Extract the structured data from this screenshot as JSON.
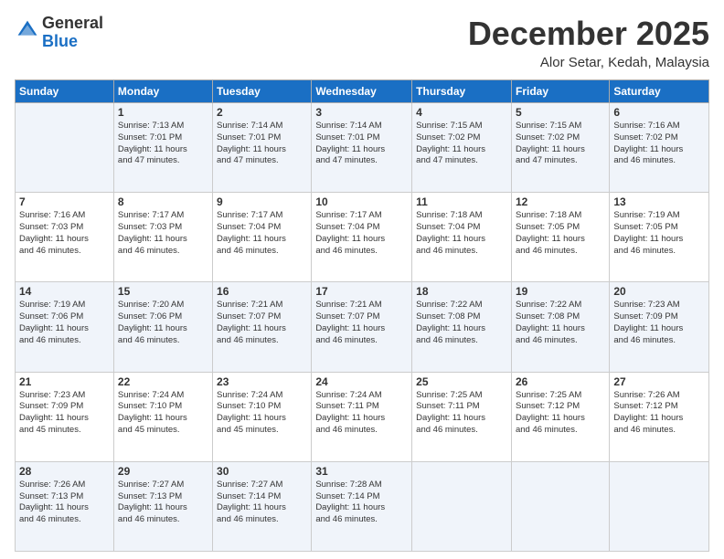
{
  "header": {
    "logo_general": "General",
    "logo_blue": "Blue",
    "month_title": "December 2025",
    "location": "Alor Setar, Kedah, Malaysia"
  },
  "days_of_week": [
    "Sunday",
    "Monday",
    "Tuesday",
    "Wednesday",
    "Thursday",
    "Friday",
    "Saturday"
  ],
  "weeks": [
    [
      {
        "day": "",
        "info": ""
      },
      {
        "day": "1",
        "info": "Sunrise: 7:13 AM\nSunset: 7:01 PM\nDaylight: 11 hours\nand 47 minutes."
      },
      {
        "day": "2",
        "info": "Sunrise: 7:14 AM\nSunset: 7:01 PM\nDaylight: 11 hours\nand 47 minutes."
      },
      {
        "day": "3",
        "info": "Sunrise: 7:14 AM\nSunset: 7:01 PM\nDaylight: 11 hours\nand 47 minutes."
      },
      {
        "day": "4",
        "info": "Sunrise: 7:15 AM\nSunset: 7:02 PM\nDaylight: 11 hours\nand 47 minutes."
      },
      {
        "day": "5",
        "info": "Sunrise: 7:15 AM\nSunset: 7:02 PM\nDaylight: 11 hours\nand 47 minutes."
      },
      {
        "day": "6",
        "info": "Sunrise: 7:16 AM\nSunset: 7:02 PM\nDaylight: 11 hours\nand 46 minutes."
      }
    ],
    [
      {
        "day": "7",
        "info": "Sunrise: 7:16 AM\nSunset: 7:03 PM\nDaylight: 11 hours\nand 46 minutes."
      },
      {
        "day": "8",
        "info": "Sunrise: 7:17 AM\nSunset: 7:03 PM\nDaylight: 11 hours\nand 46 minutes."
      },
      {
        "day": "9",
        "info": "Sunrise: 7:17 AM\nSunset: 7:04 PM\nDaylight: 11 hours\nand 46 minutes."
      },
      {
        "day": "10",
        "info": "Sunrise: 7:17 AM\nSunset: 7:04 PM\nDaylight: 11 hours\nand 46 minutes."
      },
      {
        "day": "11",
        "info": "Sunrise: 7:18 AM\nSunset: 7:04 PM\nDaylight: 11 hours\nand 46 minutes."
      },
      {
        "day": "12",
        "info": "Sunrise: 7:18 AM\nSunset: 7:05 PM\nDaylight: 11 hours\nand 46 minutes."
      },
      {
        "day": "13",
        "info": "Sunrise: 7:19 AM\nSunset: 7:05 PM\nDaylight: 11 hours\nand 46 minutes."
      }
    ],
    [
      {
        "day": "14",
        "info": "Sunrise: 7:19 AM\nSunset: 7:06 PM\nDaylight: 11 hours\nand 46 minutes."
      },
      {
        "day": "15",
        "info": "Sunrise: 7:20 AM\nSunset: 7:06 PM\nDaylight: 11 hours\nand 46 minutes."
      },
      {
        "day": "16",
        "info": "Sunrise: 7:21 AM\nSunset: 7:07 PM\nDaylight: 11 hours\nand 46 minutes."
      },
      {
        "day": "17",
        "info": "Sunrise: 7:21 AM\nSunset: 7:07 PM\nDaylight: 11 hours\nand 46 minutes."
      },
      {
        "day": "18",
        "info": "Sunrise: 7:22 AM\nSunset: 7:08 PM\nDaylight: 11 hours\nand 46 minutes."
      },
      {
        "day": "19",
        "info": "Sunrise: 7:22 AM\nSunset: 7:08 PM\nDaylight: 11 hours\nand 46 minutes."
      },
      {
        "day": "20",
        "info": "Sunrise: 7:23 AM\nSunset: 7:09 PM\nDaylight: 11 hours\nand 46 minutes."
      }
    ],
    [
      {
        "day": "21",
        "info": "Sunrise: 7:23 AM\nSunset: 7:09 PM\nDaylight: 11 hours\nand 45 minutes."
      },
      {
        "day": "22",
        "info": "Sunrise: 7:24 AM\nSunset: 7:10 PM\nDaylight: 11 hours\nand 45 minutes."
      },
      {
        "day": "23",
        "info": "Sunrise: 7:24 AM\nSunset: 7:10 PM\nDaylight: 11 hours\nand 45 minutes."
      },
      {
        "day": "24",
        "info": "Sunrise: 7:24 AM\nSunset: 7:11 PM\nDaylight: 11 hours\nand 46 minutes."
      },
      {
        "day": "25",
        "info": "Sunrise: 7:25 AM\nSunset: 7:11 PM\nDaylight: 11 hours\nand 46 minutes."
      },
      {
        "day": "26",
        "info": "Sunrise: 7:25 AM\nSunset: 7:12 PM\nDaylight: 11 hours\nand 46 minutes."
      },
      {
        "day": "27",
        "info": "Sunrise: 7:26 AM\nSunset: 7:12 PM\nDaylight: 11 hours\nand 46 minutes."
      }
    ],
    [
      {
        "day": "28",
        "info": "Sunrise: 7:26 AM\nSunset: 7:13 PM\nDaylight: 11 hours\nand 46 minutes."
      },
      {
        "day": "29",
        "info": "Sunrise: 7:27 AM\nSunset: 7:13 PM\nDaylight: 11 hours\nand 46 minutes."
      },
      {
        "day": "30",
        "info": "Sunrise: 7:27 AM\nSunset: 7:14 PM\nDaylight: 11 hours\nand 46 minutes."
      },
      {
        "day": "31",
        "info": "Sunrise: 7:28 AM\nSunset: 7:14 PM\nDaylight: 11 hours\nand 46 minutes."
      },
      {
        "day": "",
        "info": ""
      },
      {
        "day": "",
        "info": ""
      },
      {
        "day": "",
        "info": ""
      }
    ]
  ]
}
